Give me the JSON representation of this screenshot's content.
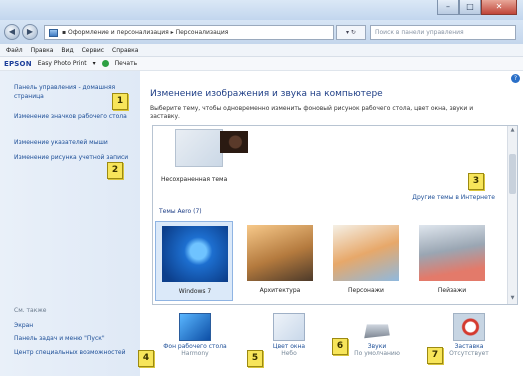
{
  "address_bar": {
    "path": "▪ Оформление и персонализация ▸ Персонализация",
    "refresh": "▾ ↻",
    "search_placeholder": "Поиск в панели управления"
  },
  "window_controls": {
    "minimize": "–",
    "maximize": "□",
    "close": "✕"
  },
  "nav": {
    "back": "◀",
    "forward": "▶"
  },
  "menu": [
    "Файл",
    "Правка",
    "Вид",
    "Сервис",
    "Справка"
  ],
  "toolbar": {
    "brand": "EPSON",
    "app": "Easy Photo Print",
    "print": "Печать"
  },
  "left_pane": {
    "links": [
      "Панель управления - домашняя страница",
      "Изменение значков рабочего стола",
      "Изменение указателей мыши",
      "Изменение рисунка учетной записи"
    ],
    "see_also_title": "См. также",
    "see_also": [
      "Экран",
      "Панель задач и меню \"Пуск\"",
      "Центр специальных возможностей"
    ]
  },
  "main": {
    "title": "Изменение изображения и звука на компьютере",
    "description": "Выберите тему, чтобы одновременно изменить фоновый рисунок рабочего стола, цвет окна, звуки и заставку.",
    "unsaved_theme": "Несохраненная тема",
    "more_themes": "Другие темы в Интернете",
    "aero_group": "Темы Aero (7)",
    "themes": [
      {
        "name": "Windows 7",
        "selected": true
      },
      {
        "name": "Архитектура",
        "selected": false
      },
      {
        "name": "Персонажи",
        "selected": false
      },
      {
        "name": "Пейзажи",
        "selected": false
      }
    ]
  },
  "bottom": [
    {
      "label": "Фон рабочего стола",
      "sub": "Harmony",
      "icon": "desktop-background-icon"
    },
    {
      "label": "Цвет окна",
      "sub": "Небо",
      "icon": "window-color-icon"
    },
    {
      "label": "Звуки",
      "sub": "По умолчанию",
      "icon": "sounds-icon"
    },
    {
      "label": "Заставка",
      "sub": "Отсутствует",
      "icon": "screensaver-icon"
    }
  ],
  "callouts": [
    "1",
    "2",
    "3",
    "4",
    "5",
    "6",
    "7"
  ],
  "colors": {
    "link": "#1c4e97",
    "callout": "#f7e55a",
    "selected_tile": "#dbe9f9"
  }
}
